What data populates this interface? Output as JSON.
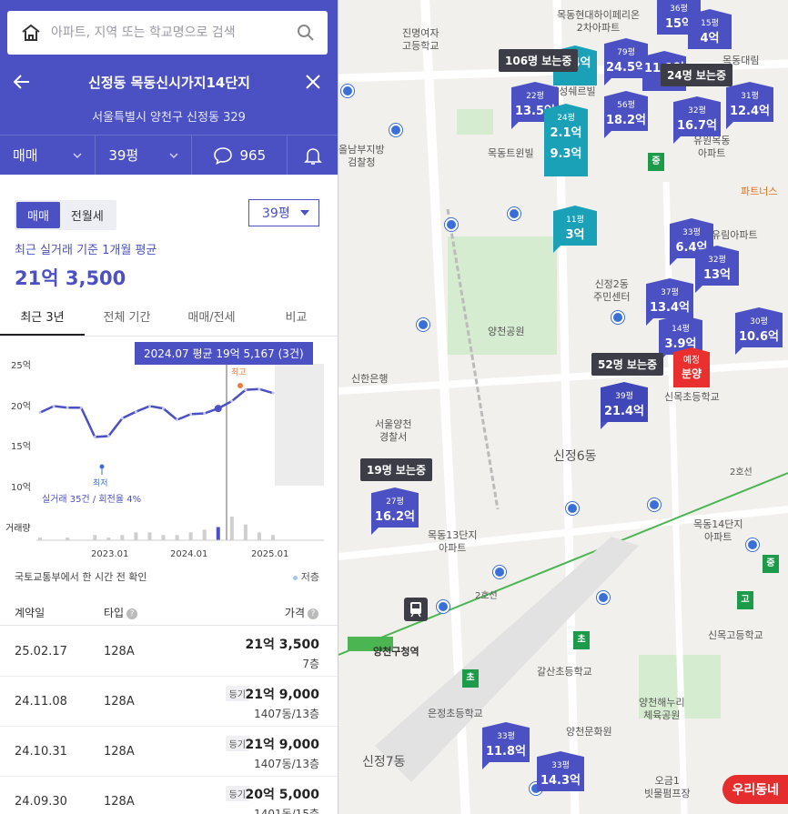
{
  "search": {
    "placeholder": "아파트, 지역 또는 학교명으로 검색"
  },
  "header": {
    "title": "신정동 목동신시가지14단지",
    "address": "서울특별시 양천구 신정동 329",
    "filters": {
      "deal": "매매",
      "size": "39평",
      "comments": "965"
    }
  },
  "trade_tabs": [
    "매매",
    "전월세"
  ],
  "size_select": "39평",
  "average": {
    "label": "최근 실거래 기준 1개월 평균",
    "price": "21억 3,500"
  },
  "period_tabs": [
    "최근 3년",
    "전체 기간",
    "매매/전세",
    "비교"
  ],
  "chart": {
    "tooltip": "2024.07 평균 19억 5,167 (3건)",
    "high_label": "최고",
    "low_label": "최저",
    "summary": "실거래 35건 / 회전율 4%",
    "volume_label": "거래량",
    "y_ticks": [
      "25억",
      "20억",
      "15억",
      "10억"
    ],
    "x_ticks": [
      "2023.01",
      "2024.01",
      "2025.01"
    ]
  },
  "chart_data": {
    "type": "line",
    "title": "",
    "xlabel": "",
    "ylabel": "",
    "ylim": [
      10,
      25
    ],
    "series": [
      {
        "x": [
          "2022.05",
          "2022.07",
          "2022.09",
          "2022.11",
          "2023.01",
          "2023.03",
          "2023.05",
          "2023.07",
          "2023.09",
          "2023.11",
          "2024.01",
          "2024.03",
          "2024.05",
          "2024.07",
          "2024.09",
          "2024.11",
          "2025.01",
          "2025.02"
        ],
        "values": [
          19.0,
          19.8,
          19.6,
          19.6,
          16.0,
          16.1,
          18.3,
          19.1,
          19.8,
          19.5,
          18.1,
          18.8,
          18.9,
          19.5,
          20.4,
          21.8,
          21.9,
          21.4
        ]
      }
    ],
    "volume": [
      1,
      0,
      1,
      0,
      2,
      1,
      2,
      3,
      3,
      2,
      2,
      3,
      4,
      5,
      9,
      6,
      3,
      2
    ]
  },
  "source": {
    "text": "국토교통부에서 한 시간 전 확인",
    "legend": "저층"
  },
  "table": {
    "headers": {
      "date": "계약일",
      "type": "타입",
      "price": "가격"
    },
    "rows": [
      {
        "date": "25.02.17",
        "type": "128A",
        "price": "21억 3,500",
        "floor": "7층",
        "registered": ""
      },
      {
        "date": "24.11.08",
        "type": "128A",
        "price": "21억 9,000",
        "floor": "1407동/13층",
        "registered": "등기"
      },
      {
        "date": "24.10.31",
        "type": "128A",
        "price": "21억 9,000",
        "floor": "1407동/13층",
        "registered": "등기"
      },
      {
        "date": "24.09.30",
        "type": "128A",
        "price": "20억 5,000",
        "floor": "1401동/15층",
        "registered": "등기"
      }
    ]
  },
  "map": {
    "viewers": [
      "106명 보는중",
      "24명 보는중",
      "52명 보는중",
      "19명 보는중"
    ],
    "pins": [
      {
        "size": "79평",
        "price": "24.5억"
      },
      {
        "size": "36평",
        "price": "15억"
      },
      {
        "size": "15평",
        "price": "4억"
      },
      {
        "size": "22평",
        "price": "13.5억"
      },
      {
        "size": "",
        "price": "5.4억"
      },
      {
        "size": "24평",
        "price": "2.1억"
      },
      {
        "size": "",
        "price": "9.3억"
      },
      {
        "size": "56평",
        "price": "18.2억"
      },
      {
        "size": "",
        "price": "11.1억"
      },
      {
        "size": "32평",
        "price": "16.7억"
      },
      {
        "size": "31평",
        "price": "12.4억"
      },
      {
        "size": "11평",
        "price": "3억"
      },
      {
        "size": "33평",
        "price": "6.4억"
      },
      {
        "size": "32평",
        "price": "13억"
      },
      {
        "size": "37평",
        "price": "13.4억"
      },
      {
        "size": "14평",
        "price": "3.9억"
      },
      {
        "size": "30평",
        "price": "10.6억"
      },
      {
        "size": "39평",
        "price": "21.4억"
      },
      {
        "size": "27평",
        "price": "16.2억"
      },
      {
        "size": "33평",
        "price": "11.8억"
      },
      {
        "size": "33평",
        "price": "14.3억"
      }
    ],
    "presale": {
      "top": "예정",
      "label": "분양"
    },
    "labels": [
      "진명여자\n고등학교",
      "목동현대하이페리온\n2차아파트",
      "목동센트럴\n아이파크위브",
      "올남부지방\n검찰청",
      "목동트윈빌",
      "목동대림",
      "유원목동\n아파트",
      "목동13단지\n아파트",
      "양천공원",
      "신정2동\n주민센터",
      "신한은행",
      "서울양천\n경찰서",
      "신정6동",
      "목동14단지\n아파트",
      "신목고등학교",
      "신목초등학교",
      "양천구청역",
      "갈산초등학교",
      "은정초등학교",
      "양천해누리\n체육공원",
      "양천문화원",
      "신정7동",
      "오금1\n빗물펌프장",
      "파트너스",
      "유림아파트",
      "삼성쉐르빌",
      "2호선",
      "2호선",
      "초",
      "중",
      "고",
      "중"
    ],
    "bottom_button": "우리동네"
  },
  "colors": {
    "brand": "#4b50c3",
    "teal": "#1aa1b8",
    "presale": "#e9302f"
  }
}
